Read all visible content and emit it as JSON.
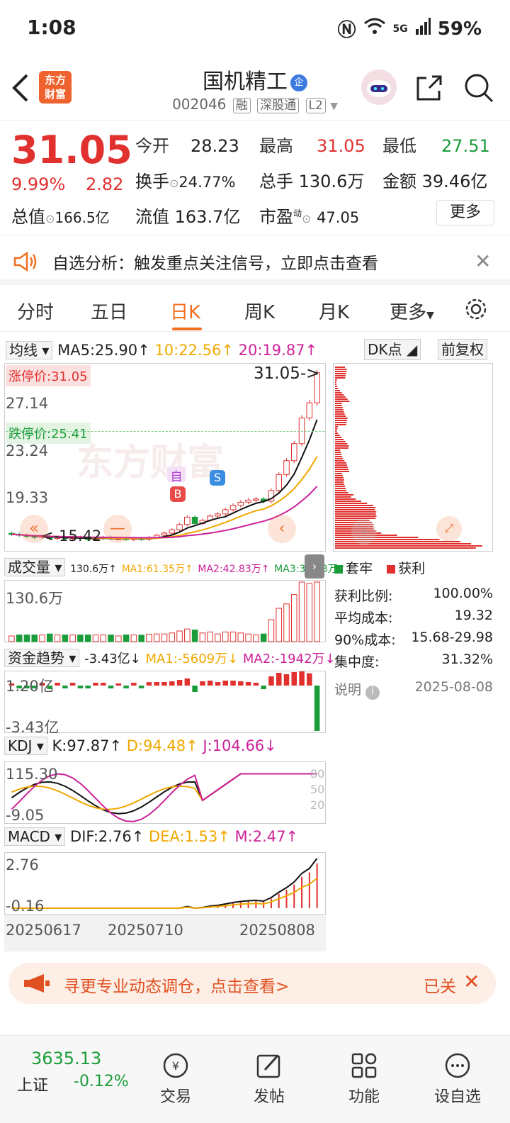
{
  "status_bar": {
    "time": "1:08",
    "network": "5G",
    "battery": "59%"
  },
  "header": {
    "logo_text_line1": "东方",
    "logo_text_line2": "财富",
    "stock_name": "国机精工",
    "badge": "企",
    "code": "002046",
    "tags": [
      "融",
      "深股通",
      "L2"
    ]
  },
  "quote": {
    "price": "31.05",
    "change_pct": "9.99%",
    "change_amt": "2.82",
    "open_label": "今开",
    "open": "28.23",
    "high_label": "最高",
    "high": "31.05",
    "low_label": "最低",
    "low": "27.51",
    "turnover_label": "换手",
    "turnover": "24.77%",
    "volume_label": "总手",
    "volume": "130.6万",
    "amount_label": "金额",
    "amount": "39.46亿",
    "mcap_label": "总值",
    "mcap": "166.5亿",
    "float_label": "流值",
    "float_mcap": "163.7亿",
    "pe_label": "市盈",
    "pe_sup": "动",
    "pe": "47.05",
    "more_button": "更多"
  },
  "notice": {
    "text": "自选分析：触发重点关注信号，立即点击查看"
  },
  "tabs": [
    "分时",
    "五日",
    "日K",
    "周K",
    "月K",
    "更多"
  ],
  "active_tab": "日K",
  "kline": {
    "ma_selector": "均线",
    "ma5": "MA5:25.90↑",
    "ma10": "10:22.56↑",
    "ma20": "20:19.87↑",
    "dk_button": "DK点",
    "adjust_button": "前复权",
    "limit_up_label": "涨停价:31.05",
    "limit_down_label": "跌停价:25.41",
    "last_price_label": "31.05->",
    "y_ticks": [
      "27.14",
      "23.24",
      "19.33"
    ],
    "low_marker": "<-15.42",
    "marker_self": "自",
    "marker_buy": "B",
    "marker_sell": "S",
    "watermark": "东方财富"
  },
  "chip": {
    "legend_trapped": "套牢",
    "legend_profit": "获利",
    "profit_ratio_label": "获利比例:",
    "profit_ratio": "100.00%",
    "avg_cost_label": "平均成本:",
    "avg_cost": "19.32",
    "cost90_label": "90%成本:",
    "cost90": "15.68-29.98",
    "concentration_label": "集中度:",
    "concentration": "31.32%",
    "note_label": "说明",
    "date": "2025-08-08"
  },
  "volume": {
    "selector": "成交量",
    "value": "130.6万↑",
    "ma1": "MA1:61.35万↑",
    "ma2": "MA2:42.83万↑",
    "ma3": "MA3:33.58万↑",
    "y_top": "130.6万"
  },
  "capital": {
    "selector": "资金趋势",
    "value": "-3.43亿↓",
    "ma1": "MA1:-5609万↓",
    "ma2": "MA2:-1942万↓",
    "y_top": "1.20亿",
    "y_bottom": "-3.43亿"
  },
  "kdj": {
    "selector": "KDJ",
    "k": "K:97.87↑",
    "d": "D:94.48↑",
    "j": "J:104.66↓",
    "y_top": "115.30",
    "y_bottom": "-9.05",
    "levels": [
      "80",
      "50",
      "20"
    ]
  },
  "macd": {
    "selector": "MACD",
    "dif": "DIF:2.76↑",
    "dea": "DEA:1.53↑",
    "m": "M:2.47↑",
    "y_top": "2.76",
    "y_bottom": "-0.16",
    "dates": [
      "20250617",
      "20250710",
      "20250808"
    ]
  },
  "banner": {
    "text": "寻更专业动态调仓，点击查看>",
    "right_text": "已关"
  },
  "bottom_bar": {
    "index_value": "3635.13",
    "index_name": "上证",
    "index_change": "-0.12%",
    "items": [
      "交易",
      "发帖",
      "功能",
      "设自选"
    ]
  },
  "colors": {
    "up": "#e0312f",
    "down": "#1a9c3a",
    "accent": "#f07020",
    "ma10": "#f0a800",
    "ma20": "#cc2299"
  },
  "chart_data": {
    "type": "candlestick",
    "closes": [
      15.9,
      15.8,
      15.7,
      15.6,
      15.7,
      15.5,
      15.6,
      15.5,
      15.6,
      15.5,
      15.4,
      15.5,
      15.6,
      15.5,
      15.5,
      15.4,
      15.5,
      15.42,
      15.6,
      15.8,
      16.0,
      16.3,
      16.8,
      17.5,
      16.9,
      17.2,
      17.6,
      17.8,
      18.2,
      18.6,
      18.9,
      19.1,
      19.2,
      19.0,
      20.0,
      21.5,
      22.8,
      24.4,
      26.8,
      28.23,
      31.05
    ],
    "ylim": [
      15.0,
      31.5
    ]
  }
}
